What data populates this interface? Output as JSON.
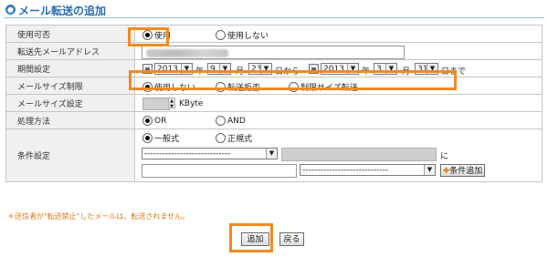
{
  "page": {
    "title": "メール転送の追加"
  },
  "rows": {
    "enable": {
      "label": "使用可否",
      "options": [
        "使用",
        "使用しない"
      ],
      "selected": 0
    },
    "forward_address": {
      "label": "転送先メールアドレス",
      "value_note": "blurred address"
    },
    "period": {
      "label": "期間設定",
      "start": {
        "year": "2013",
        "month": "9",
        "day": "23"
      },
      "end": {
        "year": "2013",
        "month": "3",
        "day": "31"
      },
      "year_unit": "年",
      "month_unit": "月",
      "from_suffix": "日から",
      "to_suffix": "日まで"
    },
    "size_limit": {
      "label": "メールサイズ制限",
      "options": [
        "使用しない",
        "転送拒否",
        "制限サイズ転送"
      ],
      "selected": 0
    },
    "size_setting": {
      "label": "メールサイズ設定",
      "unit": "KByte"
    },
    "method": {
      "label": "処理方法",
      "options": [
        "OR",
        "AND"
      ],
      "selected": 0
    },
    "conditions": {
      "label": "条件設定",
      "types": [
        "一般式",
        "正規式"
      ],
      "selected": 0,
      "dropdown1": "-----------------------------",
      "ni": "に",
      "dropdown2": "-----------------------------",
      "add_condition": "条件追加"
    }
  },
  "note": "＊送信者が\"転送禁止\"したメールは、転送されません。",
  "buttons": {
    "add": "追加",
    "back": "戻る"
  },
  "colors": {
    "highlight": "#f08a24",
    "title": "#2a6db0",
    "label_bg": "#eef0f2",
    "note": "#e07a10"
  }
}
